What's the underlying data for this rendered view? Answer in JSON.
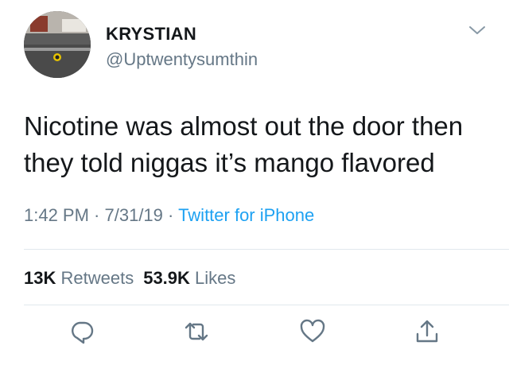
{
  "user": {
    "display_name": "KRYSTIAN",
    "handle": "@Uptwentysumthin",
    "avatar_icon": "profile-photo-street"
  },
  "tweet": {
    "line1": "Nicotine was almost out the door then",
    "line2": "they told niggas it’s mango flavored"
  },
  "meta": {
    "time": "1:42 PM",
    "date": "7/31/19",
    "separator": " · ",
    "source": "Twitter for iPhone"
  },
  "stats": {
    "retweets_count": "13K",
    "retweets_label": "Retweets",
    "likes_count": "53.9K",
    "likes_label": "Likes"
  },
  "actions": [
    {
      "icon": "reply-icon"
    },
    {
      "icon": "retweet-icon"
    },
    {
      "icon": "like-heart-icon"
    },
    {
      "icon": "share-icon"
    }
  ],
  "colors": {
    "text": "#14171a",
    "secondary": "#657786",
    "link": "#1da1f2",
    "divider": "#e1e8ed"
  }
}
